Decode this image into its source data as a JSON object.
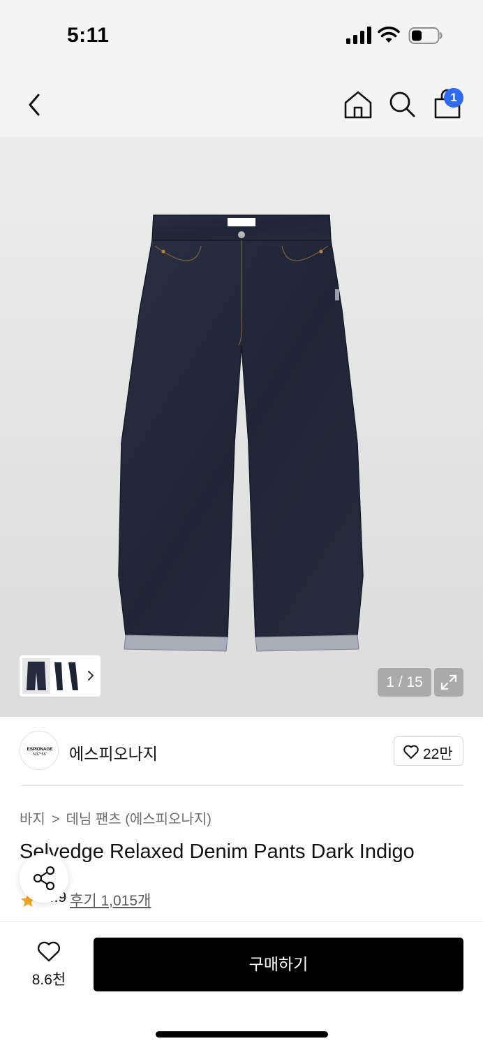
{
  "status_bar": {
    "time": "5:11",
    "icons": [
      "signal-icon",
      "wifi-icon",
      "battery-icon"
    ]
  },
  "nav": {
    "icons": [
      "back-icon",
      "home-icon",
      "search-icon",
      "shopping-bag-icon"
    ],
    "cart_count": "1",
    "badge_color": "#2f6af3"
  },
  "gallery": {
    "counter": "1 / 15",
    "thumbnail_icon": "jeans-thumbnail",
    "expand_icon": "expand-icon"
  },
  "brand": {
    "logo_text": "ESPIONAGE",
    "logo_subtext": "N37°56'",
    "name": "에스피오나지",
    "like_count": "22만"
  },
  "product": {
    "breadcrumb": [
      "바지",
      "데님 팬츠 (에스피오나지)"
    ],
    "title": "Selvedge Relaxed Denim Pants Dark Indigo",
    "rating": "4.9",
    "reviews": "후기 1,015개",
    "star_color": "#f5a623"
  },
  "bottom_bar": {
    "wish_count": "8.6천",
    "buy_label": "구매하기"
  }
}
